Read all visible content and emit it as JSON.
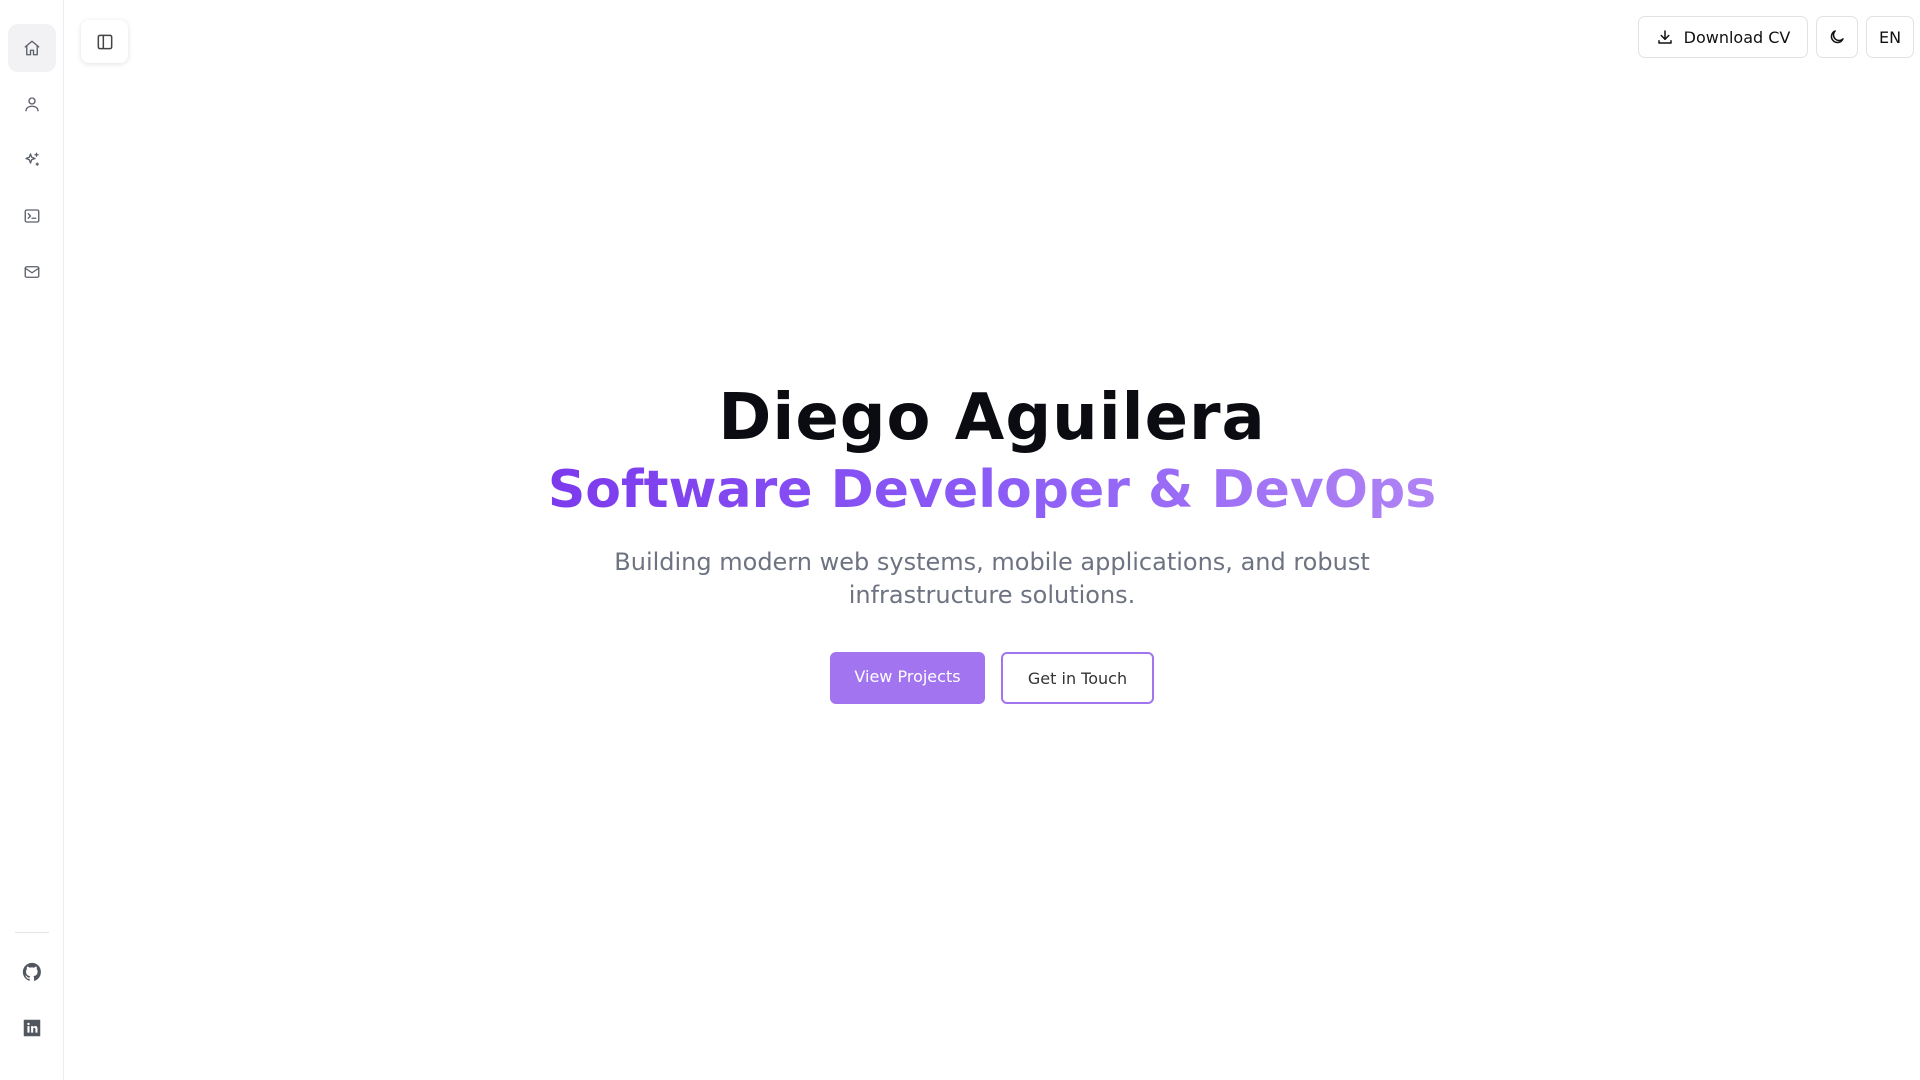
{
  "sidebar": {
    "items": [
      {
        "icon": "home-icon",
        "active": true
      },
      {
        "icon": "user-icon",
        "active": false
      },
      {
        "icon": "sparkles-icon",
        "active": false
      },
      {
        "icon": "terminal-icon",
        "active": false
      },
      {
        "icon": "mail-icon",
        "active": false
      }
    ],
    "social": [
      {
        "icon": "github-icon"
      },
      {
        "icon": "linkedin-icon"
      }
    ]
  },
  "topbar": {
    "download_cv_label": "Download CV",
    "theme_icon": "moon-icon",
    "language_label": "EN"
  },
  "hero": {
    "name": "Diego Aguilera",
    "role": "Software Developer & DevOps",
    "tagline": "Building modern web systems, mobile applications, and robust infrastructure solutions.",
    "primary_cta": "View Projects",
    "secondary_cta": "Get in Touch"
  },
  "colors": {
    "accent": "#a274f0",
    "gradient_start": "#7c3aed",
    "gradient_end": "#b084f5",
    "muted_text": "#6e7382"
  }
}
